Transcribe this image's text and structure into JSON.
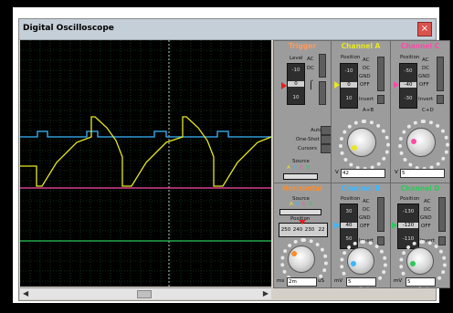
{
  "window": {
    "title": "Digital Oscilloscope",
    "close_label": "×"
  },
  "trigger": {
    "title": "Trigger",
    "level_label": "Level",
    "level_ticks": [
      "-10",
      "0",
      "10"
    ],
    "ac_label": "AC",
    "dc_label": "DC",
    "auto_label": "Auto",
    "oneshot_label": "One-Shot",
    "cursors_label": "Cursors",
    "source_label": "Source",
    "source_channels": [
      "A",
      "B",
      "C",
      "D"
    ]
  },
  "channels": {
    "a": {
      "title": "Channel A",
      "color": "#e8e820",
      "position_label": "Position",
      "ticks": [
        "-10",
        "0",
        "10"
      ],
      "modes": [
        "AC",
        "DC",
        "GND",
        "OFF"
      ],
      "invert_label": "Invert",
      "extra_label": "A+B",
      "value": "42",
      "unit": "V"
    },
    "c": {
      "title": "Channel C",
      "color": "#ff4aa8",
      "position_label": "Position",
      "ticks": [
        "-50",
        "-40",
        "-30"
      ],
      "modes": [
        "AC",
        "DC",
        "GND",
        "OFF"
      ],
      "invert_label": "Invert",
      "extra_label": "C+D",
      "value": "5",
      "unit": "V"
    },
    "b": {
      "title": "Channel B",
      "color": "#3ab8ff",
      "position_label": "Position",
      "ticks": [
        "30",
        "40",
        "50"
      ],
      "modes": [
        "AC",
        "DC",
        "GND",
        "OFF"
      ],
      "invert_label": "Invert",
      "value": "5",
      "unit": "mV"
    },
    "d": {
      "title": "Channel D",
      "color": "#2ec85a",
      "position_label": "Position",
      "ticks": [
        "-130",
        "-120",
        "-110"
      ],
      "modes": [
        "AC",
        "DC",
        "GND",
        "OFF"
      ],
      "invert_label": "Invert",
      "value": "5",
      "unit": "mV"
    }
  },
  "horizontal": {
    "title": "Horizontal",
    "source_label": "Source",
    "source_channels": [
      "A",
      "B",
      "C",
      "D"
    ],
    "position_label": "Position",
    "position_ticks": [
      "250",
      "240",
      "230",
      "22"
    ],
    "timebase_value": "2m",
    "timebase_units": [
      "ms",
      "uS"
    ]
  },
  "colors": {
    "trigger_title": "#ff9a5a",
    "horizontal_title": "#ff8c2a",
    "grid": "#1f5a2c",
    "center_line": "#c8c8c8"
  }
}
